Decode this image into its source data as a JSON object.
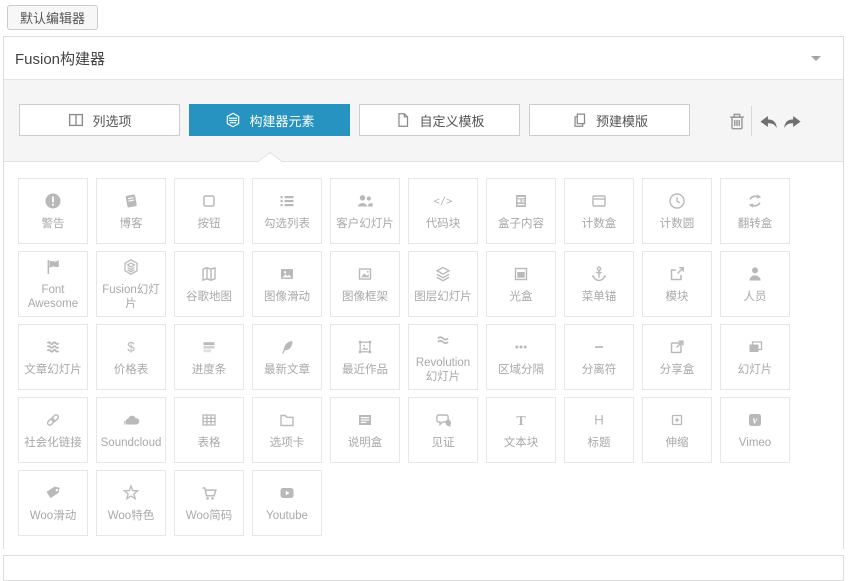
{
  "header": {
    "default_editor_button": "默认编辑器",
    "builder_title": "Fusion构建器"
  },
  "toolbar": {
    "active_color": "#2793c1",
    "tabs": [
      {
        "label": "列选项",
        "icon": "columns-icon",
        "active": false
      },
      {
        "label": "构建器元素",
        "icon": "element-icon",
        "active": true
      },
      {
        "label": "自定义模板",
        "icon": "file-icon",
        "active": false
      },
      {
        "label": "预建模版",
        "icon": "copy-icon",
        "active": false
      }
    ],
    "actions": [
      {
        "name": "delete",
        "icon": "trash-icon"
      },
      {
        "name": "undo",
        "icon": "undo-icon"
      },
      {
        "name": "redo",
        "icon": "redo-icon"
      }
    ]
  },
  "elements": [
    {
      "label": "警告",
      "icon": "exclamation-circle-icon"
    },
    {
      "label": "博客",
      "icon": "book-icon"
    },
    {
      "label": "按钮",
      "icon": "square-icon"
    },
    {
      "label": "勾选列表",
      "icon": "checklist-icon"
    },
    {
      "label": "客户幻灯片",
      "icon": "users-icon"
    },
    {
      "label": "代码块",
      "icon": "code-icon"
    },
    {
      "label": "盒子内容",
      "icon": "newspaper-icon"
    },
    {
      "label": "计数盒",
      "icon": "browser-window-icon"
    },
    {
      "label": "计数圆",
      "icon": "clock-icon"
    },
    {
      "label": "翻转盒",
      "icon": "flip-arrows-icon"
    },
    {
      "label": "Font Awesome",
      "icon": "flag-icon"
    },
    {
      "label": "Fusion幻灯片",
      "icon": "fusion-cube-icon"
    },
    {
      "label": "谷歌地图",
      "icon": "map-icon"
    },
    {
      "label": "图像滑动",
      "icon": "image-filled-icon"
    },
    {
      "label": "图像框架",
      "icon": "image-frame-icon"
    },
    {
      "label": "图层幻灯片",
      "icon": "layers-icon"
    },
    {
      "label": "光盒",
      "icon": "lightbox-icon"
    },
    {
      "label": "菜单锚",
      "icon": "anchor-icon"
    },
    {
      "label": "模块",
      "icon": "external-link-icon"
    },
    {
      "label": "人员",
      "icon": "person-icon"
    },
    {
      "label": "文章幻灯片",
      "icon": "waves-stack-icon"
    },
    {
      "label": "价格表",
      "icon": "dollar-icon"
    },
    {
      "label": "进度条",
      "icon": "progress-bars-icon"
    },
    {
      "label": "最新文章",
      "icon": "feather-icon"
    },
    {
      "label": "最近作品",
      "icon": "framed-image-icon"
    },
    {
      "label": "Revolution幻灯片",
      "icon": "approx-waves-icon"
    },
    {
      "label": "区域分隔",
      "icon": "ellipsis-icon"
    },
    {
      "label": "分离符",
      "icon": "minus-icon"
    },
    {
      "label": "分享盒",
      "icon": "share-box-icon"
    },
    {
      "label": "幻灯片",
      "icon": "stacked-slides-icon"
    },
    {
      "label": "社会化链接",
      "icon": "chain-link-icon"
    },
    {
      "label": "Soundcloud",
      "icon": "cloud-icon"
    },
    {
      "label": "表格",
      "icon": "table-grid-icon"
    },
    {
      "label": "选项卡",
      "icon": "folder-icon"
    },
    {
      "label": "说明盒",
      "icon": "tagline-box-icon"
    },
    {
      "label": "见证",
      "icon": "comments-icon"
    },
    {
      "label": "文本块",
      "icon": "letter-t-icon"
    },
    {
      "label": "标题",
      "icon": "letter-h-icon"
    },
    {
      "label": "伸缩",
      "icon": "plus-square-icon"
    },
    {
      "label": "Vimeo",
      "icon": "vimeo-icon"
    },
    {
      "label": "Woo滑动",
      "icon": "tag-icon"
    },
    {
      "label": "Woo特色",
      "icon": "star-icon"
    },
    {
      "label": "Woo简码",
      "icon": "cart-icon"
    },
    {
      "label": "Youtube",
      "icon": "youtube-icon"
    }
  ]
}
